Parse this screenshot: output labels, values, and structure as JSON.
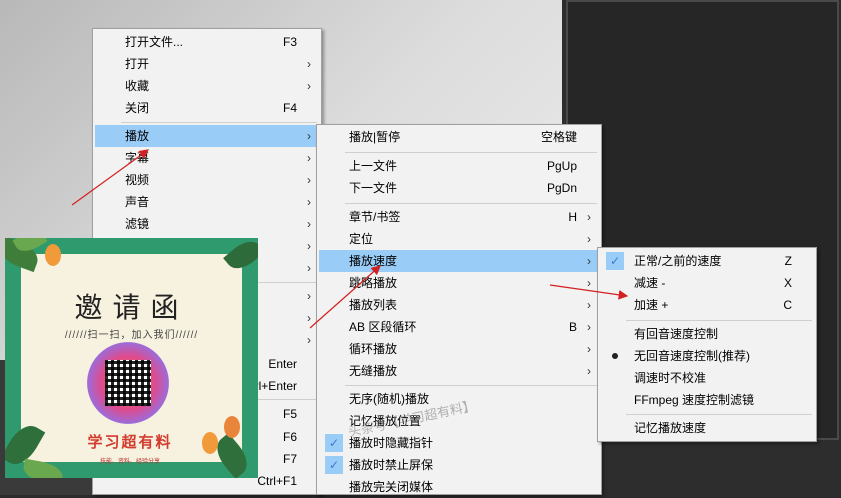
{
  "menu_main": {
    "items": [
      {
        "label": "打开文件...",
        "shortcut": "F3",
        "submenu": false
      },
      {
        "label": "打开",
        "shortcut": "",
        "submenu": true
      },
      {
        "label": "收藏",
        "shortcut": "",
        "submenu": true
      },
      {
        "label": "关闭",
        "shortcut": "F4",
        "submenu": false
      },
      {
        "label": "播放",
        "shortcut": "",
        "submenu": true,
        "highlighted": true
      },
      {
        "label": "字幕",
        "shortcut": "",
        "submenu": true
      },
      {
        "label": "视频",
        "shortcut": "",
        "submenu": true
      },
      {
        "label": "声音",
        "shortcut": "",
        "submenu": true
      },
      {
        "label": "滤镜",
        "shortcut": "",
        "submenu": true
      }
    ],
    "hidden_shortcuts": [
      "Enter",
      "rl+Enter",
      "F5",
      "F6",
      "F7",
      "Ctrl+F1"
    ]
  },
  "menu_play": {
    "items": [
      {
        "label": "播放|暂停",
        "shortcut": "空格键",
        "submenu": false
      },
      {
        "label": "上一文件",
        "shortcut": "PgUp",
        "submenu": false
      },
      {
        "label": "下一文件",
        "shortcut": "PgDn",
        "submenu": false
      },
      {
        "label": "章节/书签",
        "shortcut": "H",
        "submenu": true
      },
      {
        "label": "定位",
        "shortcut": "",
        "submenu": true
      },
      {
        "label": "播放速度",
        "shortcut": "",
        "submenu": true,
        "highlighted": true
      },
      {
        "label": "跳略播放",
        "shortcut": "",
        "submenu": true
      },
      {
        "label": "播放列表",
        "shortcut": "",
        "submenu": true
      },
      {
        "label": "AB 区段循环",
        "shortcut": "B",
        "submenu": true
      },
      {
        "label": "循环播放",
        "shortcut": "",
        "submenu": true
      },
      {
        "label": "无缝播放",
        "shortcut": "",
        "submenu": true
      },
      {
        "label": "无序(随机)播放",
        "shortcut": "",
        "submenu": false
      },
      {
        "label": "记忆播放位置",
        "shortcut": "",
        "submenu": false
      },
      {
        "label": "播放时隐藏指针",
        "shortcut": "",
        "submenu": false,
        "checked": true
      },
      {
        "label": "播放时禁止屏保",
        "shortcut": "",
        "submenu": false,
        "checked": true
      },
      {
        "label": "播放完关闭媒体",
        "shortcut": "",
        "submenu": false
      }
    ]
  },
  "menu_speed": {
    "items": [
      {
        "label": "正常/之前的速度",
        "shortcut": "Z",
        "checked": true
      },
      {
        "label": "减速 -",
        "shortcut": "X"
      },
      {
        "label": "加速 +",
        "shortcut": "C"
      },
      {
        "label": "有回音速度控制",
        "shortcut": ""
      },
      {
        "label": "无回音速度控制(推荐)",
        "shortcut": "",
        "radio": true
      },
      {
        "label": "调速时不校准",
        "shortcut": ""
      },
      {
        "label": "FFmpeg 速度控制滤镜",
        "shortcut": ""
      },
      {
        "label": "记忆播放速度",
        "shortcut": ""
      }
    ]
  },
  "poster": {
    "title": "邀请函",
    "subtitle": "//////扫一扫，加入我们//////",
    "brand": "学习超有料",
    "brand_sub": "技能、资料、经验分享"
  },
  "watermark": "头条号【学习超有料】",
  "colors": {
    "highlight": "#99ccf7",
    "menu_bg": "#f2f2f2",
    "arrow": "#d42020",
    "poster_green": "#2f9a6d"
  }
}
